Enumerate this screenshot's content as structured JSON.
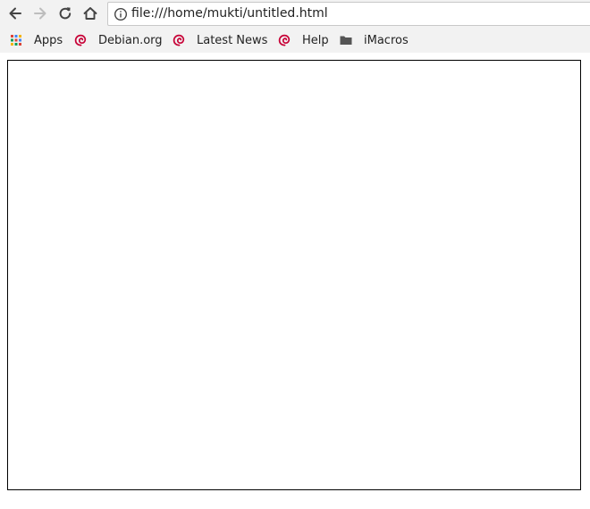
{
  "toolbar": {
    "url": "file:///home/mukti/untitled.html"
  },
  "bookmarks": [
    {
      "label": "Apps",
      "icon": "apps-grid-icon"
    },
    {
      "label": "Debian.org",
      "icon": "debian-swirl-icon"
    },
    {
      "label": "Latest News",
      "icon": "debian-swirl-icon"
    },
    {
      "label": "Help",
      "icon": "debian-swirl-icon"
    },
    {
      "label": "iMacros",
      "icon": "folder-icon"
    }
  ],
  "colors": {
    "debian_red": "#c70036",
    "chrome_bg": "#f2f2f2"
  }
}
